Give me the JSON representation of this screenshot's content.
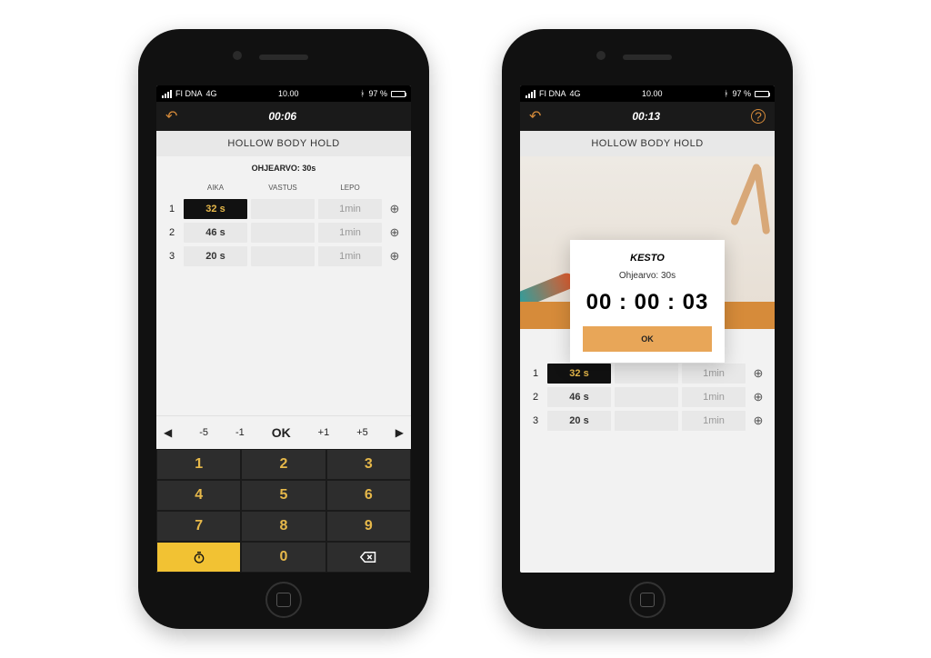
{
  "status": {
    "carrier": "FI DNA",
    "net": "4G",
    "time": "10.00",
    "bt": "97 %"
  },
  "left": {
    "nav_time": "00:06",
    "title": "HOLLOW BODY HOLD",
    "target": "OHJEARVO: 30s",
    "cols": {
      "c1": "AIKA",
      "c2": "VASTUS",
      "c3": "LEPO"
    },
    "rows": [
      {
        "idx": "1",
        "time": "32 s",
        "rest": "1min",
        "active": true
      },
      {
        "idx": "2",
        "time": "46 s",
        "rest": "1min",
        "active": false
      },
      {
        "idx": "3",
        "time": "20 s",
        "rest": "1min",
        "active": false
      }
    ],
    "step": {
      "m5": "-5",
      "m1": "-1",
      "ok": "OK",
      "p1": "+1",
      "p5": "+5"
    },
    "keys": {
      "k1": "1",
      "k2": "2",
      "k3": "3",
      "k4": "4",
      "k5": "5",
      "k6": "6",
      "k7": "7",
      "k8": "8",
      "k9": "9",
      "k0": "0"
    }
  },
  "right": {
    "nav_time": "00:13",
    "title": "HOLLOW BODY HOLD",
    "modal": {
      "title": "KESTO",
      "target": "Ohjearvo: 30s",
      "time": "00 : 00 : 03",
      "ok": "OK"
    },
    "rows": [
      {
        "idx": "1",
        "time": "32 s",
        "rest": "1min",
        "active": true
      },
      {
        "idx": "2",
        "time": "46 s",
        "rest": "1min",
        "active": false
      },
      {
        "idx": "3",
        "time": "20 s",
        "rest": "1min",
        "active": false
      }
    ]
  }
}
